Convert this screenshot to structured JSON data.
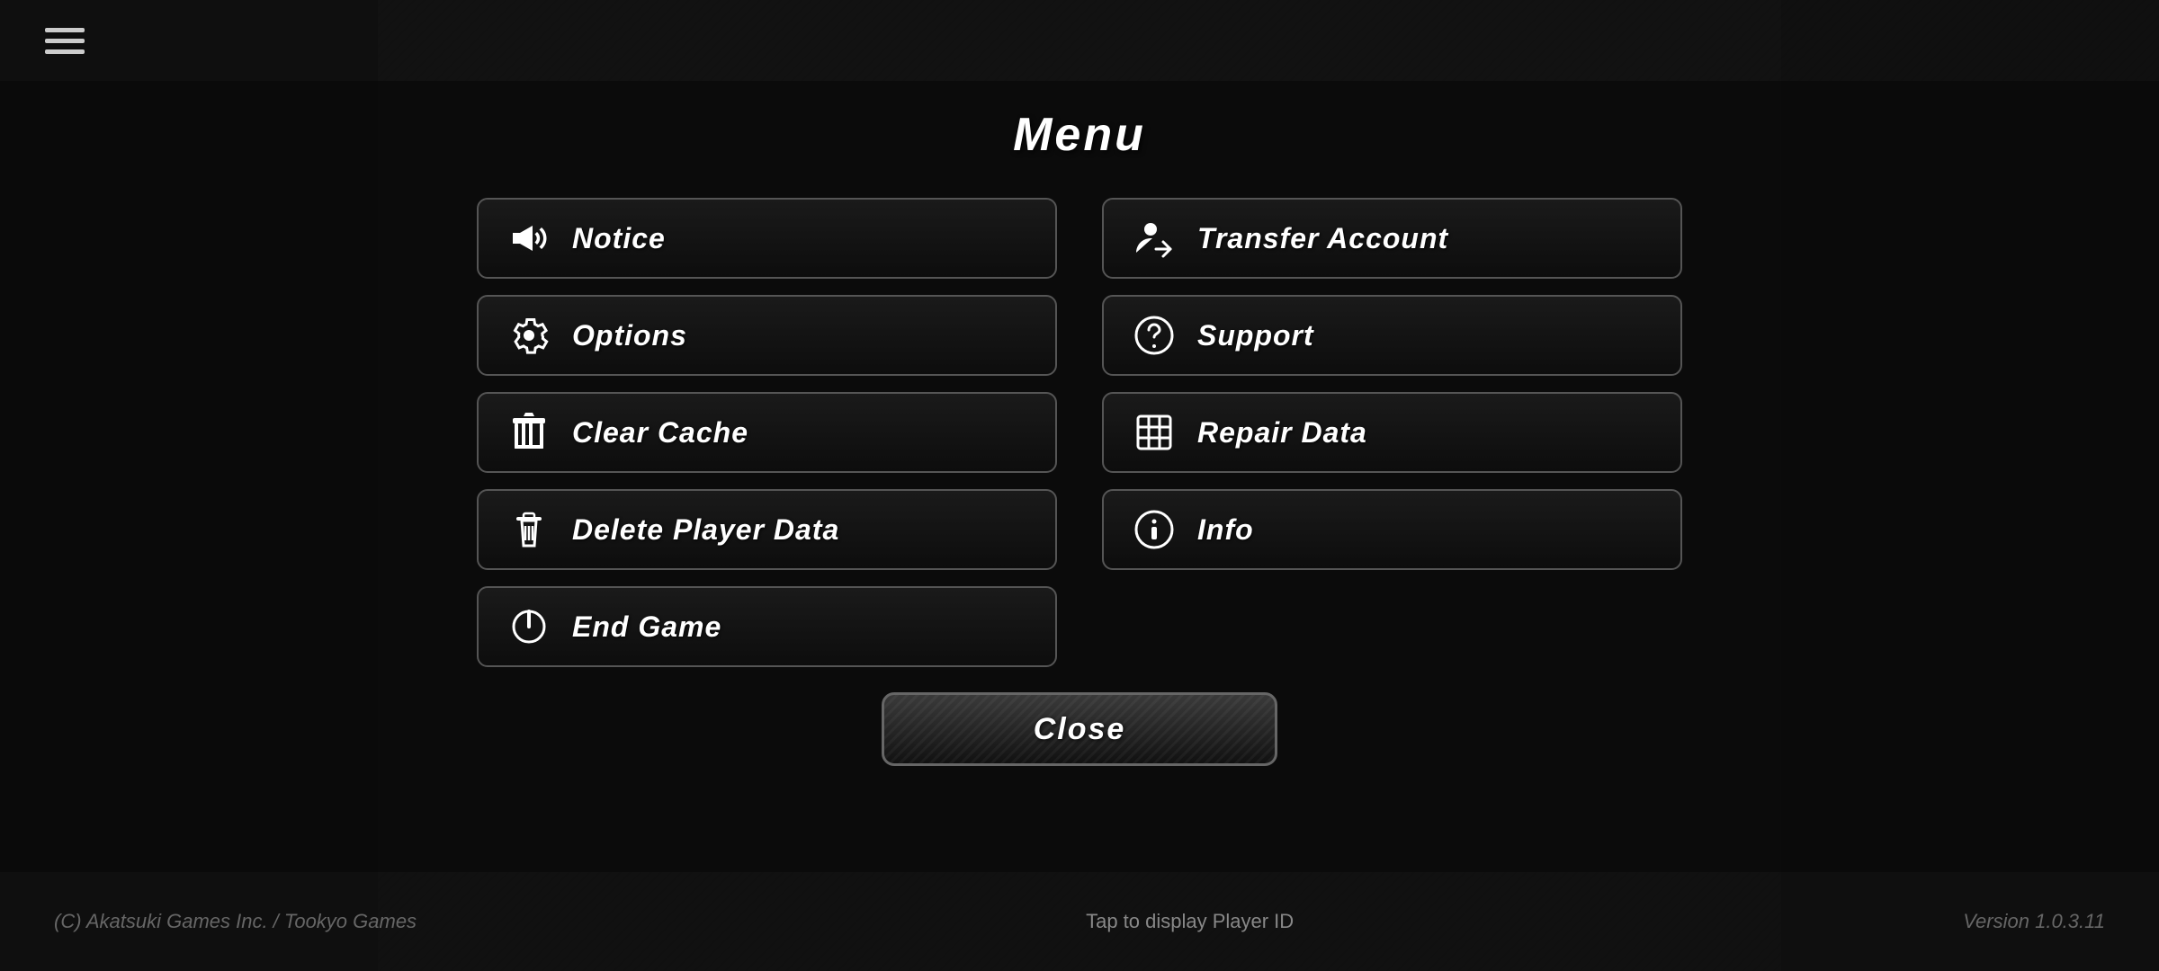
{
  "background": {
    "color": "#222222"
  },
  "topbar": {
    "hamburger_label": "menu"
  },
  "bottombar": {
    "copyright": "(C) Akatsuki Games Inc. / Tookyo Games",
    "player_id_tap": "Tap to display Player ID",
    "version": "Version 1.0.3.11"
  },
  "menu": {
    "title": "Menu",
    "buttons": [
      {
        "id": "notice",
        "label": "Notice",
        "icon": "notice-icon",
        "col": 1
      },
      {
        "id": "transfer-account",
        "label": "Transfer Account",
        "icon": "transfer-icon",
        "col": 2
      },
      {
        "id": "options",
        "label": "Options",
        "icon": "options-icon",
        "col": 1
      },
      {
        "id": "support",
        "label": "Support",
        "icon": "support-icon",
        "col": 2
      },
      {
        "id": "clear-cache",
        "label": "Clear Cache",
        "icon": "cache-icon",
        "col": 1
      },
      {
        "id": "repair-data",
        "label": "Repair Data",
        "icon": "repair-icon",
        "col": 2
      },
      {
        "id": "delete-player-data",
        "label": "Delete Player Data",
        "icon": "delete-icon",
        "col": 1
      },
      {
        "id": "info",
        "label": "Info",
        "icon": "info-icon",
        "col": 2
      },
      {
        "id": "end-game",
        "label": "End Game",
        "icon": "power-icon",
        "col": 1
      }
    ],
    "close_label": "Close"
  }
}
